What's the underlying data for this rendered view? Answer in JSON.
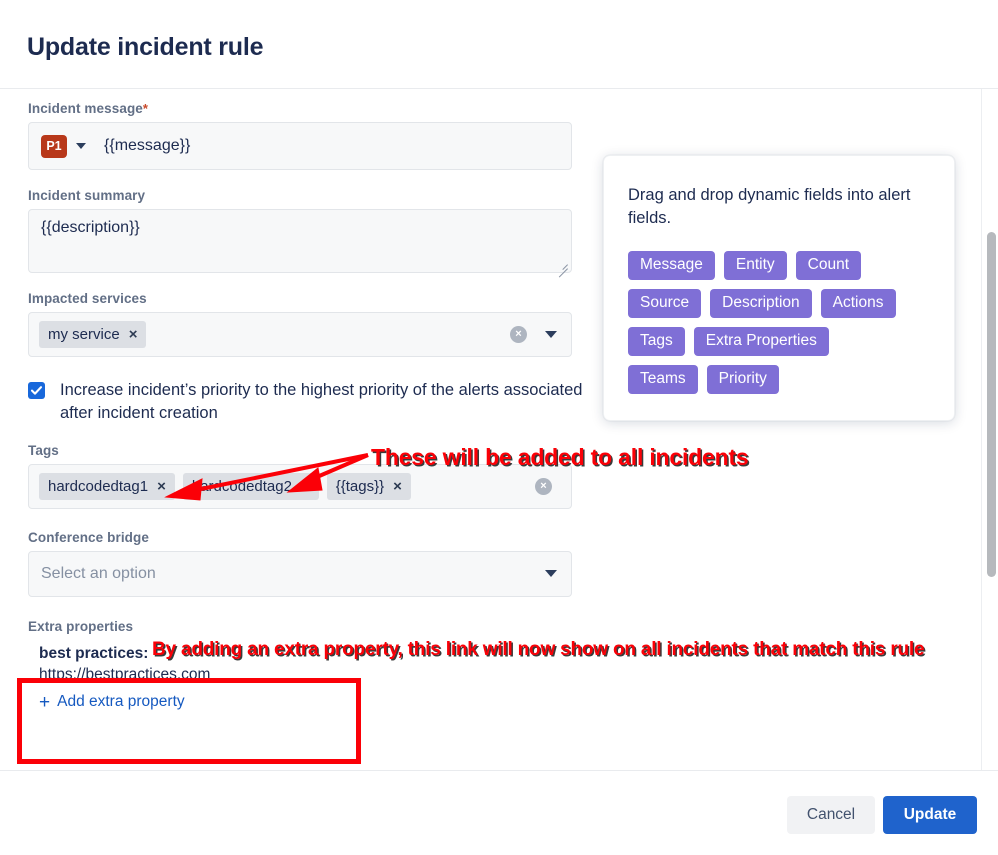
{
  "dialog": {
    "title": "Update incident rule"
  },
  "form": {
    "incident_message": {
      "label": "Incident message",
      "required_marker": "*",
      "priority_badge": "P1",
      "value": "{{message}}"
    },
    "incident_summary": {
      "label": "Incident summary",
      "value": "{{description}}"
    },
    "impacted_services": {
      "label": "Impacted services",
      "tokens": [
        "my service"
      ],
      "remove_glyph": "×",
      "clear_glyph": "×"
    },
    "priority_checkbox": {
      "checked": true,
      "label": "Increase incident’s priority to the highest priority of the alerts associated after incident creation"
    },
    "tags": {
      "label": "Tags",
      "tokens": [
        "hardcodedtag1",
        "hardcodedtag2",
        "{{tags}}"
      ],
      "remove_glyph": "×",
      "clear_glyph": "×"
    },
    "conference_bridge": {
      "label": "Conference bridge",
      "placeholder": "Select an option"
    },
    "extra_properties": {
      "label": "Extra properties",
      "items": [
        {
          "key": "best practices:",
          "value": "https://bestpractices.com"
        }
      ],
      "add_label": "Add extra property",
      "add_plus_glyph": "+"
    }
  },
  "dynamic_fields_panel": {
    "description": "Drag and drop dynamic fields into alert fields.",
    "rows": [
      [
        "Message",
        "Entity",
        "Count"
      ],
      [
        "Source",
        "Description",
        "Actions"
      ],
      [
        "Tags",
        "Extra Properties"
      ],
      [
        "Teams",
        "Priority"
      ]
    ]
  },
  "footer": {
    "cancel_label": "Cancel",
    "update_label": "Update"
  },
  "annotations": {
    "tags_note": "These will be added to all incidents",
    "extra_property_note": "By adding an extra property, this link will now show on all incidents that match this rule"
  },
  "colors": {
    "annotation_red": "#fb0007",
    "primary_blue": "#1f63cc",
    "chip_purple": "#7f6fd6",
    "p1_badge": "#b8381a",
    "link_blue": "#1559c0",
    "title_navy": "#1d2b50"
  }
}
